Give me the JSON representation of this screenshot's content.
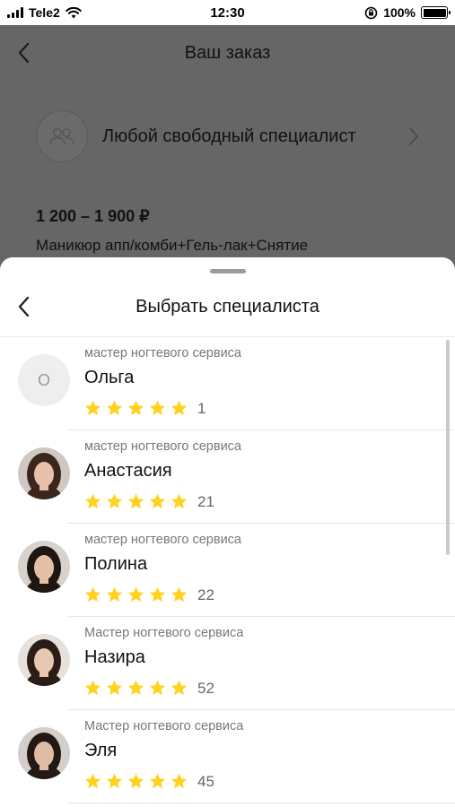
{
  "status_bar": {
    "carrier": "Tele2",
    "time": "12:30",
    "battery_percent": "100%",
    "battery_level": 1.0
  },
  "background_page": {
    "title": "Ваш заказ",
    "specialist_label": "Любой свободный специалист",
    "price": "1 200 – 1 900 ₽",
    "service": "Маникюр апп/комби+Гель-лак+Снятие"
  },
  "sheet": {
    "title": "Выбрать специалиста",
    "specialists": [
      {
        "role": "мастер ногтевого сервиса",
        "name": "Ольга",
        "rating_stars": 5,
        "reviews": "1",
        "avatar": {
          "type": "letter",
          "letter": "О"
        }
      },
      {
        "role": "мастер ногтевого сервиса",
        "name": "Анастасия",
        "rating_stars": 5,
        "reviews": "21",
        "avatar": {
          "type": "photo",
          "skin": "#e8c2a8",
          "hair": "#3a261c",
          "bg": "#cfc8c2"
        }
      },
      {
        "role": "мастер ногтевого сервиса",
        "name": "Полина",
        "rating_stars": 5,
        "reviews": "22",
        "avatar": {
          "type": "photo",
          "skin": "#e3bfa6",
          "hair": "#1e1612",
          "bg": "#d8d2cc"
        }
      },
      {
        "role": "Мастер ногтевого сервиса",
        "name": "Назира",
        "rating_stars": 5,
        "reviews": "52",
        "avatar": {
          "type": "photo",
          "skin": "#e8c7b0",
          "hair": "#2a1c16",
          "bg": "#e6e1dc"
        }
      },
      {
        "role": "Мастер ногтевого сервиса",
        "name": "Эля",
        "rating_stars": 5,
        "reviews": "45",
        "avatar": {
          "type": "photo",
          "skin": "#e1bca4",
          "hair": "#231813",
          "bg": "#d3cec9"
        }
      }
    ]
  },
  "colors": {
    "star": "#ffd21f",
    "overlay": "#5f5f5f"
  },
  "icons": {
    "back": "chevron-left-icon",
    "specialist": "people-icon",
    "chevron": "chevron-right-icon",
    "star": "star-icon"
  }
}
